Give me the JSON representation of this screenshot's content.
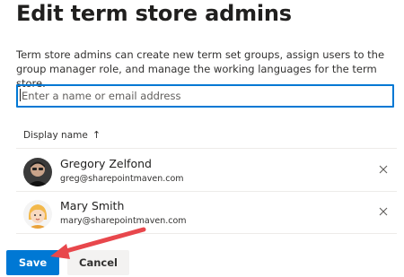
{
  "panel": {
    "title": "Edit term store admins",
    "description": "Term store admins can create new term set groups, assign users to the group manager role, and manage the working languages for the term store."
  },
  "search": {
    "placeholder": "Enter a name or email address",
    "value": ""
  },
  "table": {
    "column_header": "Display name",
    "sort_icon": "arrow-up-icon",
    "rows": [
      {
        "name": "Gregory Zelfond",
        "email": "greg@sharepointmaven.com",
        "avatar": "photo-avatar"
      },
      {
        "name": "Mary Smith",
        "email": "mary@sharepointmaven.com",
        "avatar": "illustrated-avatar"
      }
    ]
  },
  "actions": {
    "save_label": "Save",
    "cancel_label": "Cancel"
  },
  "colors": {
    "accent": "#0078d4",
    "annotation_arrow": "#e8474c"
  }
}
